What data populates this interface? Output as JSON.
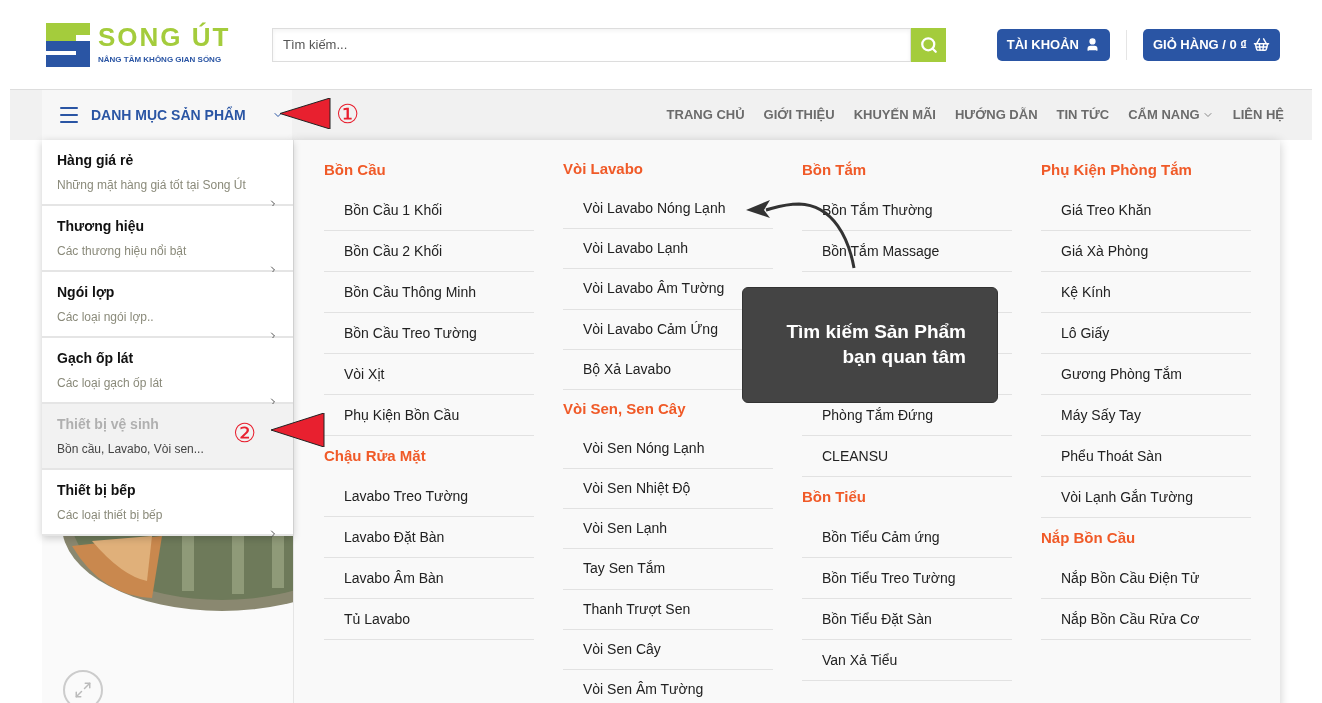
{
  "logo": {
    "brand": "SONG ÚT",
    "tagline": "NÂNG TẦM KHÔNG GIAN SỐNG"
  },
  "search": {
    "placeholder": "Tìm kiếm..."
  },
  "account_button": "TÀI KHOẢN",
  "cart_button": "GIỎ HÀNG / 0 ₫",
  "category_button": "DANH MỤC SẢN PHẨM",
  "nav": [
    {
      "label": "TRANG CHỦ",
      "dropdown": false
    },
    {
      "label": "GIỚI THIỆU",
      "dropdown": false
    },
    {
      "label": "KHUYẾN MÃI",
      "dropdown": false
    },
    {
      "label": "HƯỚNG DẪN",
      "dropdown": false
    },
    {
      "label": "TIN TỨC",
      "dropdown": false
    },
    {
      "label": "CẨM NANG",
      "dropdown": true
    },
    {
      "label": "LIÊN HỆ",
      "dropdown": false
    }
  ],
  "sidebar": [
    {
      "title": "Hàng giá rẻ",
      "subtitle": "Những mặt hàng giá tốt tại Song Út",
      "selected": false
    },
    {
      "title": "Thương hiệu",
      "subtitle": "Các thương hiệu nổi bật",
      "selected": false
    },
    {
      "title": "Ngói lợp",
      "subtitle": "Các loại ngói lợp..",
      "selected": false
    },
    {
      "title": "Gạch ốp lát",
      "subtitle": "Các loại gạch ốp lát",
      "selected": false
    },
    {
      "title": "Thiết bị vệ sinh",
      "subtitle": "Bồn cầu, Lavabo, Vòi sen...",
      "selected": true
    },
    {
      "title": "Thiết bị bếp",
      "subtitle": "Các loại thiết bị bếp",
      "selected": false
    }
  ],
  "mega_menu": [
    [
      {
        "kind": "heading",
        "label": "Bồn Cầu"
      },
      {
        "kind": "item",
        "label": "Bồn Cầu 1 Khối"
      },
      {
        "kind": "item",
        "label": "Bồn Cầu 2 Khối"
      },
      {
        "kind": "item",
        "label": "Bồn Cầu Thông Minh"
      },
      {
        "kind": "item",
        "label": "Bồn Cầu Treo Tường"
      },
      {
        "kind": "item",
        "label": "Vòi Xịt"
      },
      {
        "kind": "item",
        "label": "Phụ Kiện Bồn Cầu"
      },
      {
        "kind": "heading",
        "label": "Chậu Rửa Mặt"
      },
      {
        "kind": "item",
        "label": "Lavabo Treo Tường"
      },
      {
        "kind": "item",
        "label": "Lavabo Đặt Bàn"
      },
      {
        "kind": "item",
        "label": "Lavabo Âm Bàn"
      },
      {
        "kind": "item",
        "label": "Tủ Lavabo"
      }
    ],
    [
      {
        "kind": "heading",
        "label": "Vòi Lavabo"
      },
      {
        "kind": "item",
        "label": "Vòi Lavabo Nóng Lạnh"
      },
      {
        "kind": "item",
        "label": "Vòi Lavabo Lạnh"
      },
      {
        "kind": "item",
        "label": "Vòi Lavabo Âm Tường"
      },
      {
        "kind": "item",
        "label": "Vòi Lavabo Cảm Ứng"
      },
      {
        "kind": "item",
        "label": "Bộ Xả Lavabo"
      },
      {
        "kind": "heading",
        "label": "Vòi Sen, Sen Cây"
      },
      {
        "kind": "item",
        "label": "Vòi Sen Nóng Lạnh"
      },
      {
        "kind": "item",
        "label": "Vòi Sen Nhiệt Độ"
      },
      {
        "kind": "item",
        "label": "Vòi Sen Lạnh"
      },
      {
        "kind": "item",
        "label": "Tay Sen Tắm"
      },
      {
        "kind": "item",
        "label": "Thanh Trượt Sen"
      },
      {
        "kind": "item",
        "label": "Vòi Sen Cây"
      },
      {
        "kind": "item",
        "label": "Vòi Sen Âm Tường"
      }
    ],
    [
      {
        "kind": "heading",
        "label": "Bồn Tắm"
      },
      {
        "kind": "item",
        "label": "Bồn Tắm Thường"
      },
      {
        "kind": "item",
        "label": "Bồn Tắm Massage"
      },
      {
        "kind": "covered"
      },
      {
        "kind": "covered"
      },
      {
        "kind": "covered"
      },
      {
        "kind": "item",
        "label": "Phòng Tắm Đứng"
      },
      {
        "kind": "item",
        "label": "CLEANSU"
      },
      {
        "kind": "heading",
        "label": "Bồn Tiểu"
      },
      {
        "kind": "item",
        "label": "Bồn Tiểu Cảm ứng"
      },
      {
        "kind": "item",
        "label": "Bồn Tiểu Treo Tường"
      },
      {
        "kind": "item",
        "label": "Bồn Tiểu Đặt Sàn"
      },
      {
        "kind": "item",
        "label": "Van Xả Tiểu"
      }
    ],
    [
      {
        "kind": "heading",
        "label": "Phụ Kiện Phòng Tắm"
      },
      {
        "kind": "item",
        "label": "Giá Treo Khăn"
      },
      {
        "kind": "item",
        "label": "Giá Xà Phòng"
      },
      {
        "kind": "item",
        "label": "Kệ Kính"
      },
      {
        "kind": "item",
        "label": "Lô Giấy"
      },
      {
        "kind": "item",
        "label": "Gương Phòng Tắm"
      },
      {
        "kind": "item",
        "label": "Máy Sấy Tay"
      },
      {
        "kind": "item",
        "label": "Phểu Thoát Sàn"
      },
      {
        "kind": "item",
        "label": "Vòi Lạnh Gắn Tường"
      },
      {
        "kind": "heading",
        "label": "Nắp Bồn Cầu"
      },
      {
        "kind": "item",
        "label": "Nắp Bồn Cầu Điện Tử"
      },
      {
        "kind": "item",
        "label": "Nắp Bồn Cầu Rửa Cơ"
      }
    ]
  ],
  "annotations": {
    "marker_1": "①",
    "marker_2": "②",
    "tooltip_line_1": "Tìm kiếm Sản Phẩm",
    "tooltip_line_2": "bạn quan tâm"
  }
}
